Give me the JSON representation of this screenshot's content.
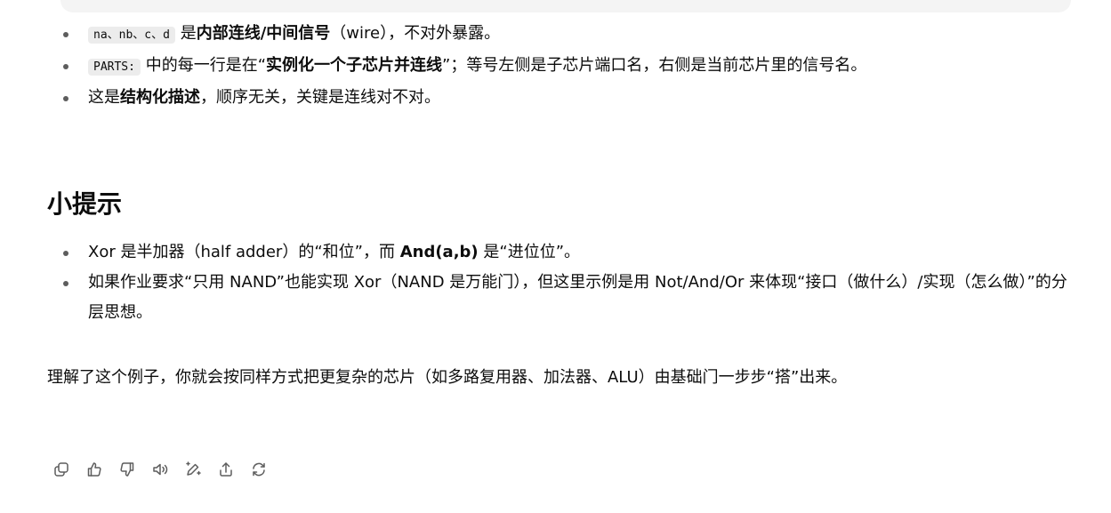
{
  "bullets_top": [
    {
      "code": "na、nb、c、d",
      "text1": " 是",
      "bold": "内部连线/中间信号",
      "text2": "（wire），不对外暴露。"
    },
    {
      "code": "PARTS:",
      "text1": " 中的每一行是在“",
      "bold": "实例化一个子芯片并连线",
      "text2": "”；等号左侧是子芯片端口名，右侧是当前芯片里的信号名。"
    },
    {
      "text1": "这是",
      "bold": "结构化描述",
      "text2": "，顺序无关，关键是连线对不对。"
    }
  ],
  "tips_heading": "小提示",
  "bullets_tips": [
    {
      "text1": "Xor 是半加器（half adder）的“和位”，而 ",
      "bold": "And(a,b)",
      "text2": " 是“进位位”。"
    },
    {
      "text1": "如果作业要求“只用 NAND”也能实现 Xor（NAND 是万能门），但这里示例是用 Not/And/Or 来体现“接口（做什么）/实现（怎么做）”的分层思想。"
    }
  ],
  "closing_paragraph": "理解了这个例子，你就会按同样方式把更复杂的芯片（如多路复用器、加法器、ALU）由基础门一步步“搭”出来。",
  "actions": [
    {
      "icon": "copy-icon"
    },
    {
      "icon": "thumbs-up-icon"
    },
    {
      "icon": "thumbs-down-icon"
    },
    {
      "icon": "speaker-icon"
    },
    {
      "icon": "edit-sparkle-icon"
    },
    {
      "icon": "share-icon"
    },
    {
      "icon": "regenerate-icon"
    }
  ]
}
